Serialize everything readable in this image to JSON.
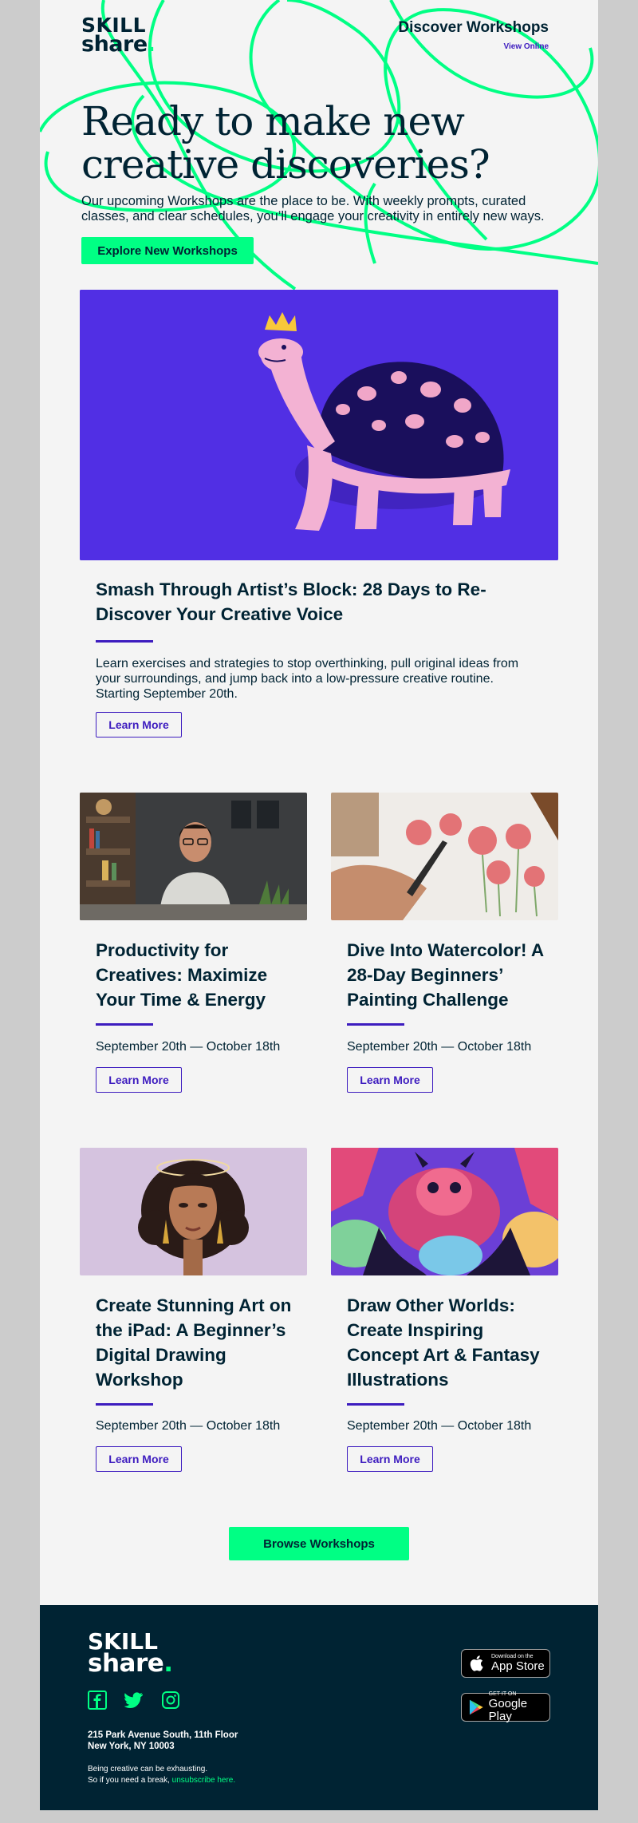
{
  "header": {
    "logo_top": "SKILL",
    "logo_bottom": "share",
    "logo_dot": ".",
    "title": "Discover Workshops",
    "view_online": "View Online"
  },
  "hero": {
    "title": "Ready to make new creative discoveries?",
    "text": "Our upcoming Workshops are the place to be. With weekly prompts, curated classes, and clear schedules, you’ll engage your creativity in entirely new ways.",
    "button": "Explore New Workshops"
  },
  "featured": {
    "title": "Smash Through Artist’s Block: 28 Days to Re-Discover Your Creative Voice",
    "text": "Learn exercises and strategies to stop overthinking, pull original ideas from your surroundings, and jump back into a low-pressure creative routine. Starting September 20th.",
    "button": "Learn More"
  },
  "cards": [
    {
      "title": "Productivity for Creatives: Maximize Your Time & Energy",
      "dates": "September 20th — October 18th",
      "button": "Learn More"
    },
    {
      "title": "Dive Into Watercolor! A 28-Day Beginners’ Painting Challenge",
      "dates": "September 20th — October 18th",
      "button": "Learn More"
    },
    {
      "title": "Create Stunning Art on the iPad: A Beginner’s Digital Drawing Workshop",
      "dates": "September 20th — October 18th",
      "button": "Learn More"
    },
    {
      "title": "Draw Other Worlds: Create Inspiring Concept Art & Fantasy Illustrations",
      "dates": "September 20th — October 18th",
      "button": "Learn More"
    }
  ],
  "browse_button": "Browse Workshops",
  "footer": {
    "logo_top": "SKILL",
    "logo_bottom": "share",
    "logo_dot": ".",
    "social_icons": [
      "facebook-icon",
      "twitter-icon",
      "instagram-icon"
    ],
    "address_line1": "215 Park Avenue South, 11th Floor",
    "address_line2": "New York, NY 10003",
    "tagline_line1": "Being creative can be exhausting.",
    "tagline_line2_prefix": "So if you need a break,",
    "unsubscribe": "unsubscribe here.",
    "app_store_small": "Download on the",
    "app_store_big": "App Store",
    "google_play_small": "GET IT ON",
    "google_play_big": "Google Play"
  },
  "colors": {
    "accent_green": "#00ff84",
    "navy": "#002333",
    "purple": "#3d1cbf",
    "background": "#f4f4f4",
    "outer_background": "#cccccc"
  }
}
